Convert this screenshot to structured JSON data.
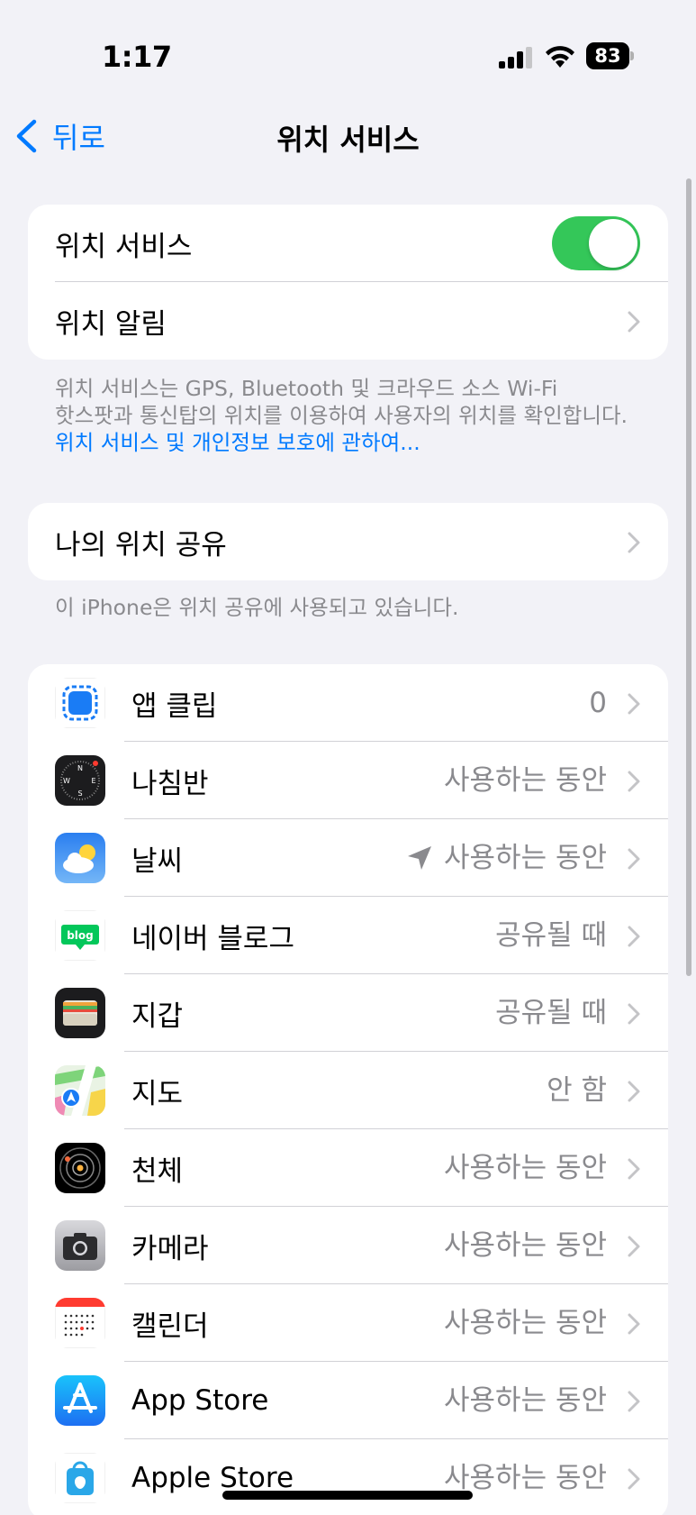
{
  "status_bar": {
    "time": "1:17",
    "battery": "83"
  },
  "nav": {
    "back_label": "뒤로",
    "title": "위치 서비스"
  },
  "location_group": {
    "location_services_label": "위치 서비스",
    "location_services_on": true,
    "location_alerts_label": "위치 알림"
  },
  "location_footer": {
    "line1": "위치 서비스는 GPS, Bluetooth 및 크라우드 소스 Wi-Fi",
    "line2": "핫스팟과 통신탑의 위치를 이용하여 사용자의 위치를 확인합니다.",
    "link": "위치 서비스 및 개인정보 보호에 관하여..."
  },
  "share_group": {
    "share_label": "나의 위치 공유"
  },
  "share_footer": "이 iPhone은 위치 공유에 사용되고 있습니다.",
  "apps": [
    {
      "name": "앱 클립",
      "value": "0",
      "icon": "app-clips-icon"
    },
    {
      "name": "나침반",
      "value": "사용하는 동안",
      "icon": "compass-icon"
    },
    {
      "name": "날씨",
      "value": "사용하는 동안",
      "icon": "weather-icon",
      "location_arrow": true
    },
    {
      "name": "네이버 블로그",
      "value": "공유될 때",
      "icon": "naver-blog-icon",
      "icon_text": "blog"
    },
    {
      "name": "지갑",
      "value": "공유될 때",
      "icon": "wallet-icon"
    },
    {
      "name": "지도",
      "value": "안 함",
      "icon": "maps-icon"
    },
    {
      "name": "천체",
      "value": "사용하는 동안",
      "icon": "astronomy-icon"
    },
    {
      "name": "카메라",
      "value": "사용하는 동안",
      "icon": "camera-icon"
    },
    {
      "name": "캘린더",
      "value": "사용하는 동안",
      "icon": "calendar-icon"
    },
    {
      "name": "App Store",
      "value": "사용하는 동안",
      "icon": "app-store-icon"
    },
    {
      "name": "Apple Store",
      "value": "사용하는 동안",
      "icon": "apple-store-icon"
    }
  ],
  "colors": {
    "accent": "#007aff",
    "toggle_on": "#34c759",
    "background": "#f2f2f7"
  }
}
